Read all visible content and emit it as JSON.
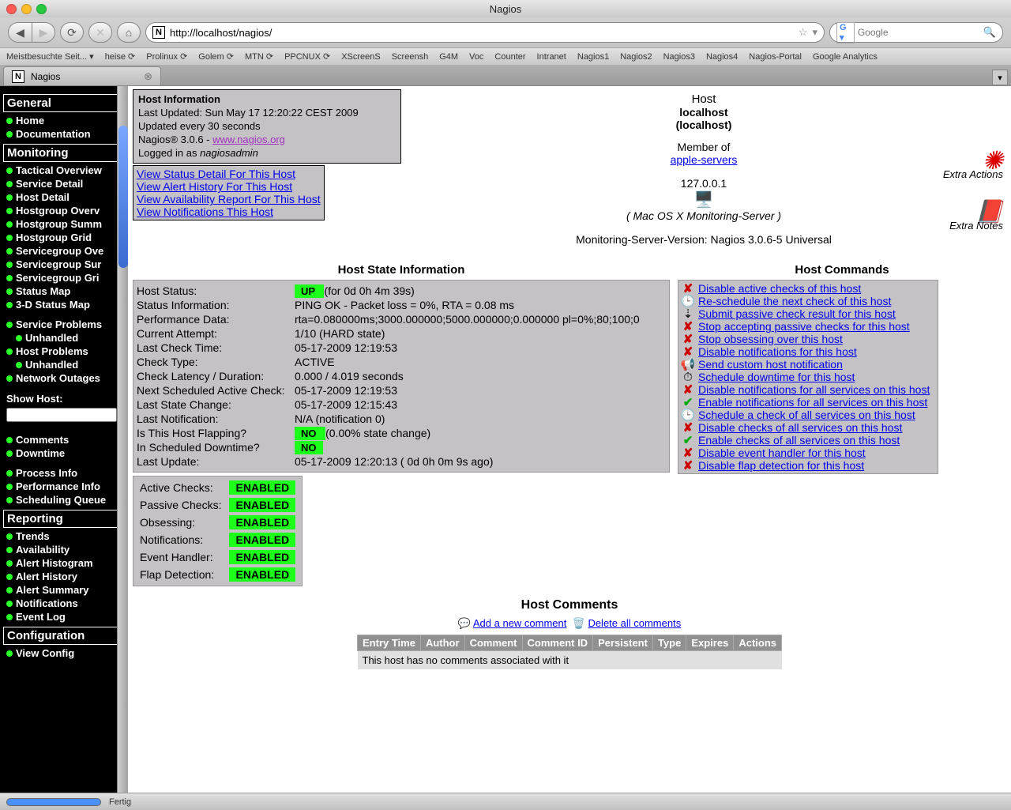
{
  "window": {
    "title": "Nagios"
  },
  "browser": {
    "url": "http://localhost/nagios/",
    "search_placeholder": "Google",
    "bookmarks": [
      "Meistbesuchte Seit... ▾",
      "heise ⟳",
      "Prolinux ⟳",
      "Golem ⟳",
      "MTN ⟳",
      "PPCNUX ⟳",
      "XScreenS",
      "Screensh",
      "G4M",
      "Voc",
      "Counter",
      "Intranet",
      "Nagios1",
      "Nagios2",
      "Nagios3",
      "Nagios4",
      "Nagios-Portal",
      "Google Analytics"
    ],
    "tab_title": "Nagios",
    "status": "Fertig"
  },
  "sidebar": {
    "general": {
      "header": "General",
      "items": [
        "Home",
        "Documentation"
      ]
    },
    "monitoring": {
      "header": "Monitoring",
      "items": [
        "Tactical Overview",
        "Service Detail",
        "Host Detail",
        "Hostgroup Overv",
        "Hostgroup Summ",
        "Hostgroup Grid",
        "Servicegroup Ove",
        "Servicegroup Sur",
        "Servicegroup Gri",
        "Status Map",
        "3-D Status Map"
      ]
    },
    "problems": {
      "items": [
        "Service Problems",
        "Unhandled",
        "Host Problems",
        "Unhandled",
        "Network Outages"
      ]
    },
    "showhost": {
      "label": "Show Host:"
    },
    "misc": {
      "items": [
        "Comments",
        "Downtime"
      ]
    },
    "misc2": {
      "items": [
        "Process Info",
        "Performance Info",
        "Scheduling Queue"
      ]
    },
    "reporting": {
      "header": "Reporting",
      "items": [
        "Trends",
        "Availability",
        "Alert Histogram",
        "Alert History",
        "Alert Summary",
        "Notifications",
        "Event Log"
      ]
    },
    "config": {
      "header": "Configuration",
      "items": [
        "View Config"
      ]
    }
  },
  "info": {
    "heading": "Host Information",
    "updated": "Last Updated: Sun May 17 12:20:22 CEST 2009",
    "interval": "Updated every 30 seconds",
    "version_pre": "Nagios® 3.0.6 - ",
    "version_link": "www.nagios.org",
    "logged_pre": "Logged in as ",
    "logged_user": "nagiosadmin",
    "links": [
      "View Status Detail For This Host",
      "View Alert History For This Host",
      "View Availability Report For This Host",
      "View Notifications This Host"
    ]
  },
  "host": {
    "label": "Host",
    "name": "localhost",
    "alias": "(localhost)",
    "memberof": "Member of",
    "group": "apple-servers",
    "address": "127.0.0.1",
    "desc": "( Mac OS X Monitoring-Server )",
    "mver": "Monitoring-Server-Version: Nagios 3.0.6-5 Universal"
  },
  "extras": {
    "actions": "Extra Actions",
    "notes": "Extra Notes"
  },
  "state": {
    "title": "Host State Information",
    "rows": [
      {
        "label": "Host Status:",
        "badge": "UP",
        "suffix": "  (for 0d 0h 4m 39s)"
      },
      {
        "label": "Status Information:",
        "value": "PING OK - Packet loss = 0%, RTA = 0.08 ms"
      },
      {
        "label": "Performance Data:",
        "value": "rta=0.080000ms;3000.000000;5000.000000;0.000000 pl=0%;80;100;0"
      },
      {
        "label": "Current Attempt:",
        "value": "1/10  (HARD state)"
      },
      {
        "label": "Last Check Time:",
        "value": "05-17-2009 12:19:53"
      },
      {
        "label": "Check Type:",
        "value": "ACTIVE"
      },
      {
        "label": "Check Latency / Duration:",
        "value": "0.000 / 4.019 seconds"
      },
      {
        "label": "Next Scheduled Active Check:",
        "value": "05-17-2009 12:19:53"
      },
      {
        "label": "Last State Change:",
        "value": "05-17-2009 12:15:43"
      },
      {
        "label": "Last Notification:",
        "value": "N/A (notification 0)"
      },
      {
        "label": "Is This Host Flapping?",
        "badge": "NO",
        "suffix": "  (0.00% state change)"
      },
      {
        "label": "In Scheduled Downtime?",
        "badge": "NO"
      },
      {
        "label": "Last Update:",
        "value": "05-17-2009 12:20:13  ( 0d 0h 0m 9s ago)"
      }
    ]
  },
  "checks": {
    "rows": [
      {
        "label": "Active Checks:",
        "value": "ENABLED"
      },
      {
        "label": "Passive Checks:",
        "value": "ENABLED"
      },
      {
        "label": "Obsessing:",
        "value": "ENABLED"
      },
      {
        "label": "Notifications:",
        "value": "ENABLED"
      },
      {
        "label": "Event Handler:",
        "value": "ENABLED"
      },
      {
        "label": "Flap Detection:",
        "value": "ENABLED"
      }
    ]
  },
  "commands": {
    "title": "Host Commands",
    "items": [
      {
        "icon": "x",
        "text": "Disable active checks of this host"
      },
      {
        "icon": "clock",
        "text": "Re-schedule the next check of this host"
      },
      {
        "icon": "passive",
        "text": "Submit passive check result for this host"
      },
      {
        "icon": "x",
        "text": "Stop accepting passive checks for this host"
      },
      {
        "icon": "x",
        "text": "Stop obsessing over this host"
      },
      {
        "icon": "x",
        "text": "Disable notifications for this host"
      },
      {
        "icon": "speaker",
        "text": "Send custom host notification"
      },
      {
        "icon": "clock2",
        "text": "Schedule downtime for this host"
      },
      {
        "icon": "x",
        "text": "Disable notifications for all services on this host"
      },
      {
        "icon": "check",
        "text": "Enable notifications for all services on this host"
      },
      {
        "icon": "clock",
        "text": "Schedule a check of all services on this host"
      },
      {
        "icon": "x",
        "text": "Disable checks of all services on this host"
      },
      {
        "icon": "check",
        "text": "Enable checks of all services on this host"
      },
      {
        "icon": "x",
        "text": "Disable event handler for this host"
      },
      {
        "icon": "x",
        "text": "Disable flap detection for this host"
      }
    ]
  },
  "comments": {
    "title": "Host Comments",
    "add": "Add a new comment",
    "delete": "Delete all comments",
    "headers": [
      "Entry Time",
      "Author",
      "Comment",
      "Comment ID",
      "Persistent",
      "Type",
      "Expires",
      "Actions"
    ],
    "empty": "This host has no comments associated with it"
  }
}
